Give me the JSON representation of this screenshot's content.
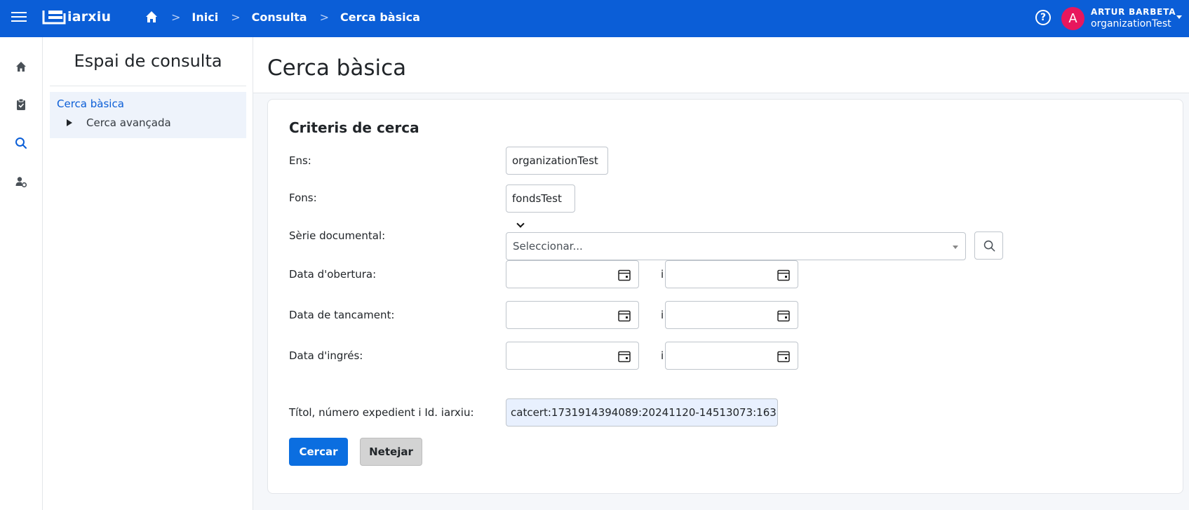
{
  "header": {
    "logo_text": "iarxiu",
    "breadcrumbs": [
      "Inici",
      "Consulta",
      "Cerca bàsica"
    ],
    "breadcrumb_separator": ">",
    "help_label": "?",
    "user": {
      "initial": "A",
      "name": "ARTUR BARBETA",
      "organization": "organizationTest"
    },
    "colors": {
      "header_bg": "#0b5ed7",
      "avatar_bg": "#e8175d"
    }
  },
  "rail": {
    "items": [
      {
        "icon": "home-icon"
      },
      {
        "icon": "clipboard-icon"
      },
      {
        "icon": "search-icon"
      },
      {
        "icon": "user-settings-icon"
      }
    ]
  },
  "sidenav": {
    "title": "Espai de consulta",
    "active_item": "Cerca bàsica",
    "sub_item": "Cerca avançada"
  },
  "main": {
    "page_title": "Cerca bàsica",
    "form": {
      "title": "Criteris de cerca",
      "ens": {
        "label": "Ens:",
        "value": "organizationTest"
      },
      "fons": {
        "label": "Fons:",
        "value": "fondsTest"
      },
      "serie": {
        "label": "Sèrie documental:",
        "placeholder": "Seleccionar..."
      },
      "date_separator": "i",
      "data_obertura": {
        "label": "Data d'obertura:"
      },
      "data_tancament": {
        "label": "Data de tancament:"
      },
      "data_ingres": {
        "label": "Data d'ingrés:"
      },
      "titol": {
        "label": "Títol, número expedient i Id. iarxiu:",
        "value": "catcert:1731914394089:20241120-14513073:163"
      },
      "search_button": "Cercar",
      "clear_button": "Netejar"
    }
  }
}
